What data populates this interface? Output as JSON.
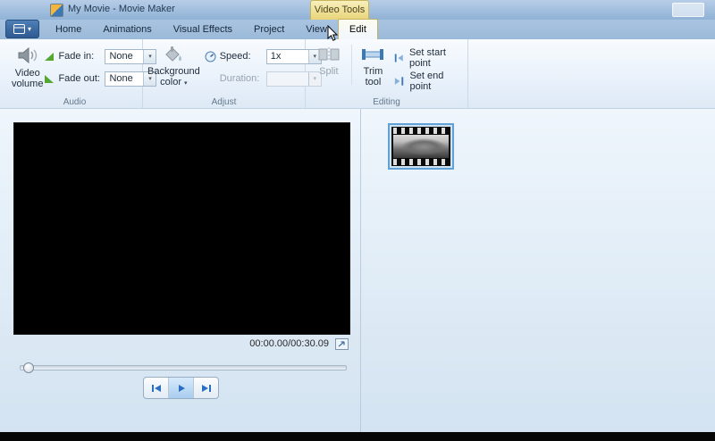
{
  "window": {
    "title": "My Movie - Movie Maker",
    "contextual_group_label": "Video Tools"
  },
  "tabs": {
    "active": "Edit",
    "items": [
      {
        "label": "Home"
      },
      {
        "label": "Animations"
      },
      {
        "label": "Visual Effects"
      },
      {
        "label": "Project"
      },
      {
        "label": "View"
      },
      {
        "label": "Edit"
      }
    ]
  },
  "ribbon": {
    "audio": {
      "group_label": "Audio",
      "video_volume": "Video volume",
      "fade_in_label": "Fade in:",
      "fade_in_value": "None",
      "fade_out_label": "Fade out:",
      "fade_out_value": "None"
    },
    "adjust": {
      "group_label": "Adjust",
      "background_color": "Background color",
      "speed_label": "Speed:",
      "speed_value": "1x",
      "duration_label": "Duration:",
      "duration_value": ""
    },
    "editing": {
      "group_label": "Editing",
      "split_label": "Split",
      "trim_tool": "Trim tool",
      "set_start": "Set start point",
      "set_end": "Set end point"
    }
  },
  "preview": {
    "timecode": "00:00.00/00:30.09"
  },
  "icons": {
    "combo_arrow": "▾",
    "menu_arrow": "▾"
  },
  "colors": {
    "titlebar_blue": "#9bb9da",
    "contextual_yellow": "#ecd87e",
    "accent_blue": "#2a6fc2",
    "selection_border": "#62a1d6"
  }
}
